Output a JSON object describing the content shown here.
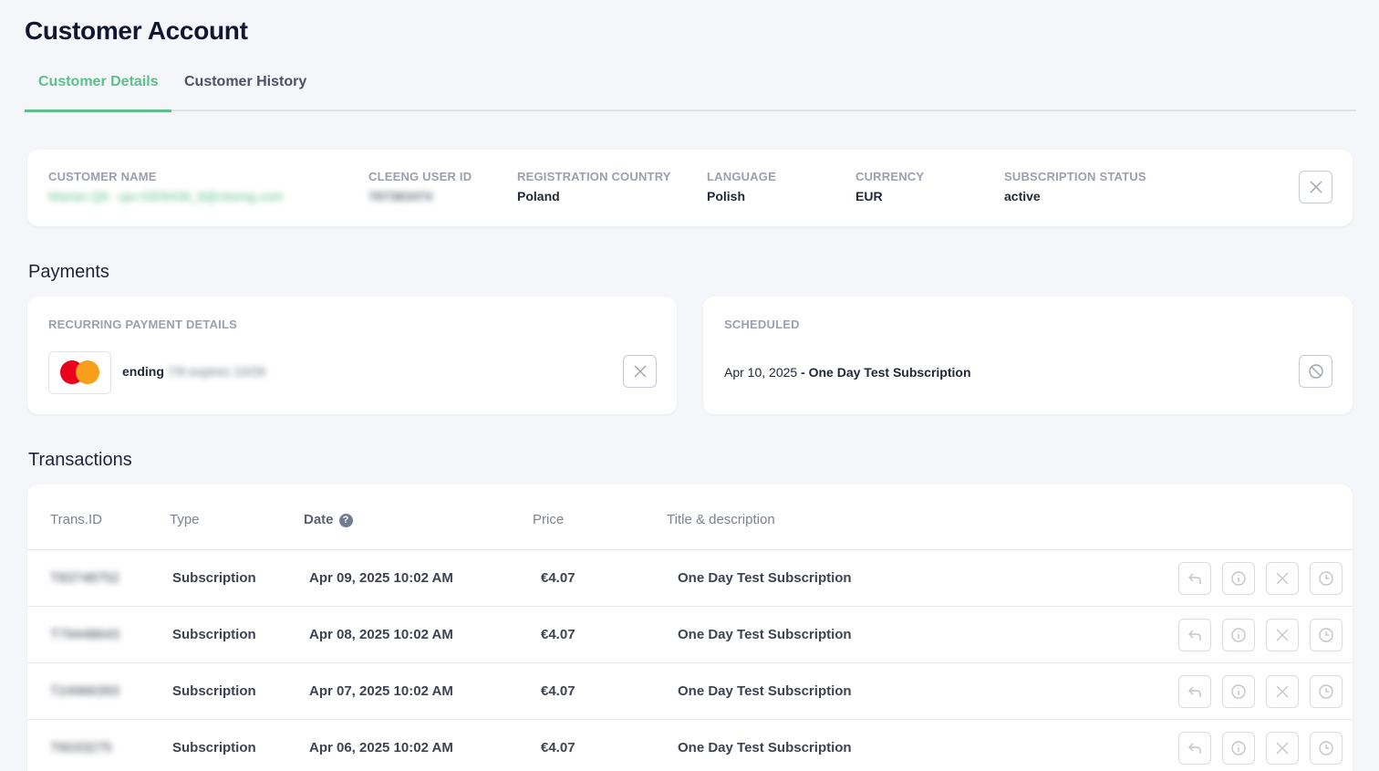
{
  "page": {
    "title": "Customer Account"
  },
  "tabs": [
    {
      "label": "Customer Details",
      "active": true
    },
    {
      "label": "Customer History",
      "active": false
    }
  ],
  "customer": {
    "name_label": "CUSTOMER NAME",
    "name_value": "Marian Q8 - qa+3309436_8@cleeng.com",
    "user_id_label": "CLEENG USER ID",
    "user_id_value": "787383474",
    "country_label": "REGISTRATION COUNTRY",
    "country_value": "Poland",
    "language_label": "LANGUAGE",
    "language_value": "Polish",
    "currency_label": "CURRENCY",
    "currency_value": "EUR",
    "status_label": "SUBSCRIPTION STATUS",
    "status_value": "active"
  },
  "payments": {
    "section_title": "Payments",
    "recurring_label": "RECURRING PAYMENT DETAILS",
    "card_prefix": "ending",
    "card_suffix": "7/9 expires 10/26",
    "scheduled_label": "SCHEDULED",
    "scheduled_date": "Apr 10, 2025",
    "scheduled_title": " - One Day Test Subscription"
  },
  "transactions": {
    "section_title": "Transactions",
    "columns": [
      "Trans.ID",
      "Type",
      "Date",
      "Price",
      "Title & description"
    ],
    "help_glyph": "?",
    "rows": [
      {
        "id": "T83748752",
        "type": "Subscription",
        "date": "Apr 09, 2025 10:02 AM",
        "price": "€4.07",
        "title": "One Day Test Subscription"
      },
      {
        "id": "T79448643",
        "type": "Subscription",
        "date": "Apr 08, 2025 10:02 AM",
        "price": "€4.07",
        "title": "One Day Test Subscription"
      },
      {
        "id": "T24966393",
        "type": "Subscription",
        "date": "Apr 07, 2025 10:02 AM",
        "price": "€4.07",
        "title": "One Day Test Subscription"
      },
      {
        "id": "T6033275",
        "type": "Subscription",
        "date": "Apr 06, 2025 10:02 AM",
        "price": "€4.07",
        "title": "One Day Test Subscription"
      }
    ]
  },
  "colors": {
    "accent": "#5cc08c",
    "background": "#f5f6f9",
    "mastercard_red": "#eb001b",
    "mastercard_orange": "#f79e1b"
  },
  "icons": {
    "card_action": "close-icon",
    "scheduled_action": "cancel-circle-icon",
    "row_actions": [
      "refund-icon",
      "info-icon",
      "close-icon",
      "clock-icon"
    ]
  }
}
